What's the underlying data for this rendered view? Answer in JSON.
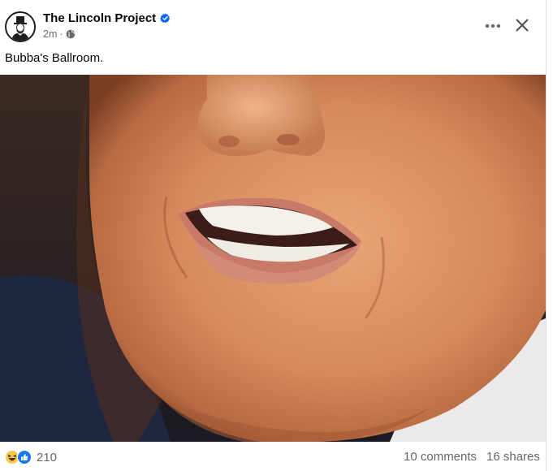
{
  "post": {
    "page_name": "The Lincoln Project",
    "timestamp": "2m",
    "separator": "·",
    "visibility_icon": "globe-icon",
    "verified_icon": "verified-badge-icon",
    "caption": "Bubba's Ballroom.",
    "image_description_icon": "photo"
  },
  "header_actions": {
    "more_icon": "more-horizontal-icon",
    "close_icon": "close-icon"
  },
  "engagement": {
    "reaction_icons": [
      "haha-icon",
      "like-icon"
    ],
    "reaction_count": "210",
    "comments": "10 comments",
    "shares": "16 shares"
  },
  "colors": {
    "verified_blue": "#0866ff",
    "secondary_text": "#65676b",
    "primary_text": "#050505"
  }
}
